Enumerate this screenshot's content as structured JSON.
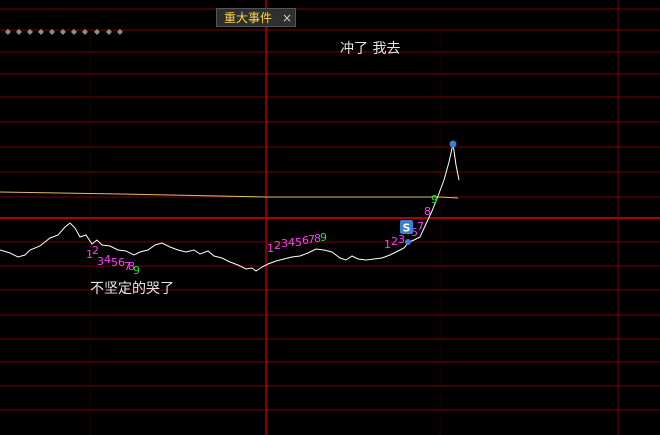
{
  "tab": {
    "label": "重大事件",
    "close_symbol": "×"
  },
  "toolbar_dots": [
    "◆",
    "◆",
    "◆",
    "◆",
    "◆",
    "◆",
    "◆",
    "◆",
    "◆",
    "◆",
    "◆"
  ],
  "annotations": {
    "top": "冲了  我去",
    "bottom": "不坚定的哭了"
  },
  "signal_badge": {
    "letter": "S",
    "color": "#3b7fd1"
  },
  "sequence_labels": {
    "left": {
      "digits": [
        "1",
        "2",
        "3",
        "4",
        "5",
        "6",
        "7",
        "8",
        "9"
      ]
    },
    "middle": {
      "digits": [
        "1",
        "2",
        "3",
        "4",
        "5",
        "6",
        "7",
        "8",
        "9"
      ]
    },
    "right": {
      "digits": [
        "1",
        "2",
        "3",
        "5",
        "7",
        "8",
        "9"
      ]
    }
  },
  "colors": {
    "grid": "#7a0000",
    "midline": "#b00000",
    "price_line": "#ffffff",
    "average_line": "#e0c060",
    "digit_magenta": "#ff3cff",
    "digit_green": "#33dd33",
    "marker_dot": "#3b7fd1"
  }
}
